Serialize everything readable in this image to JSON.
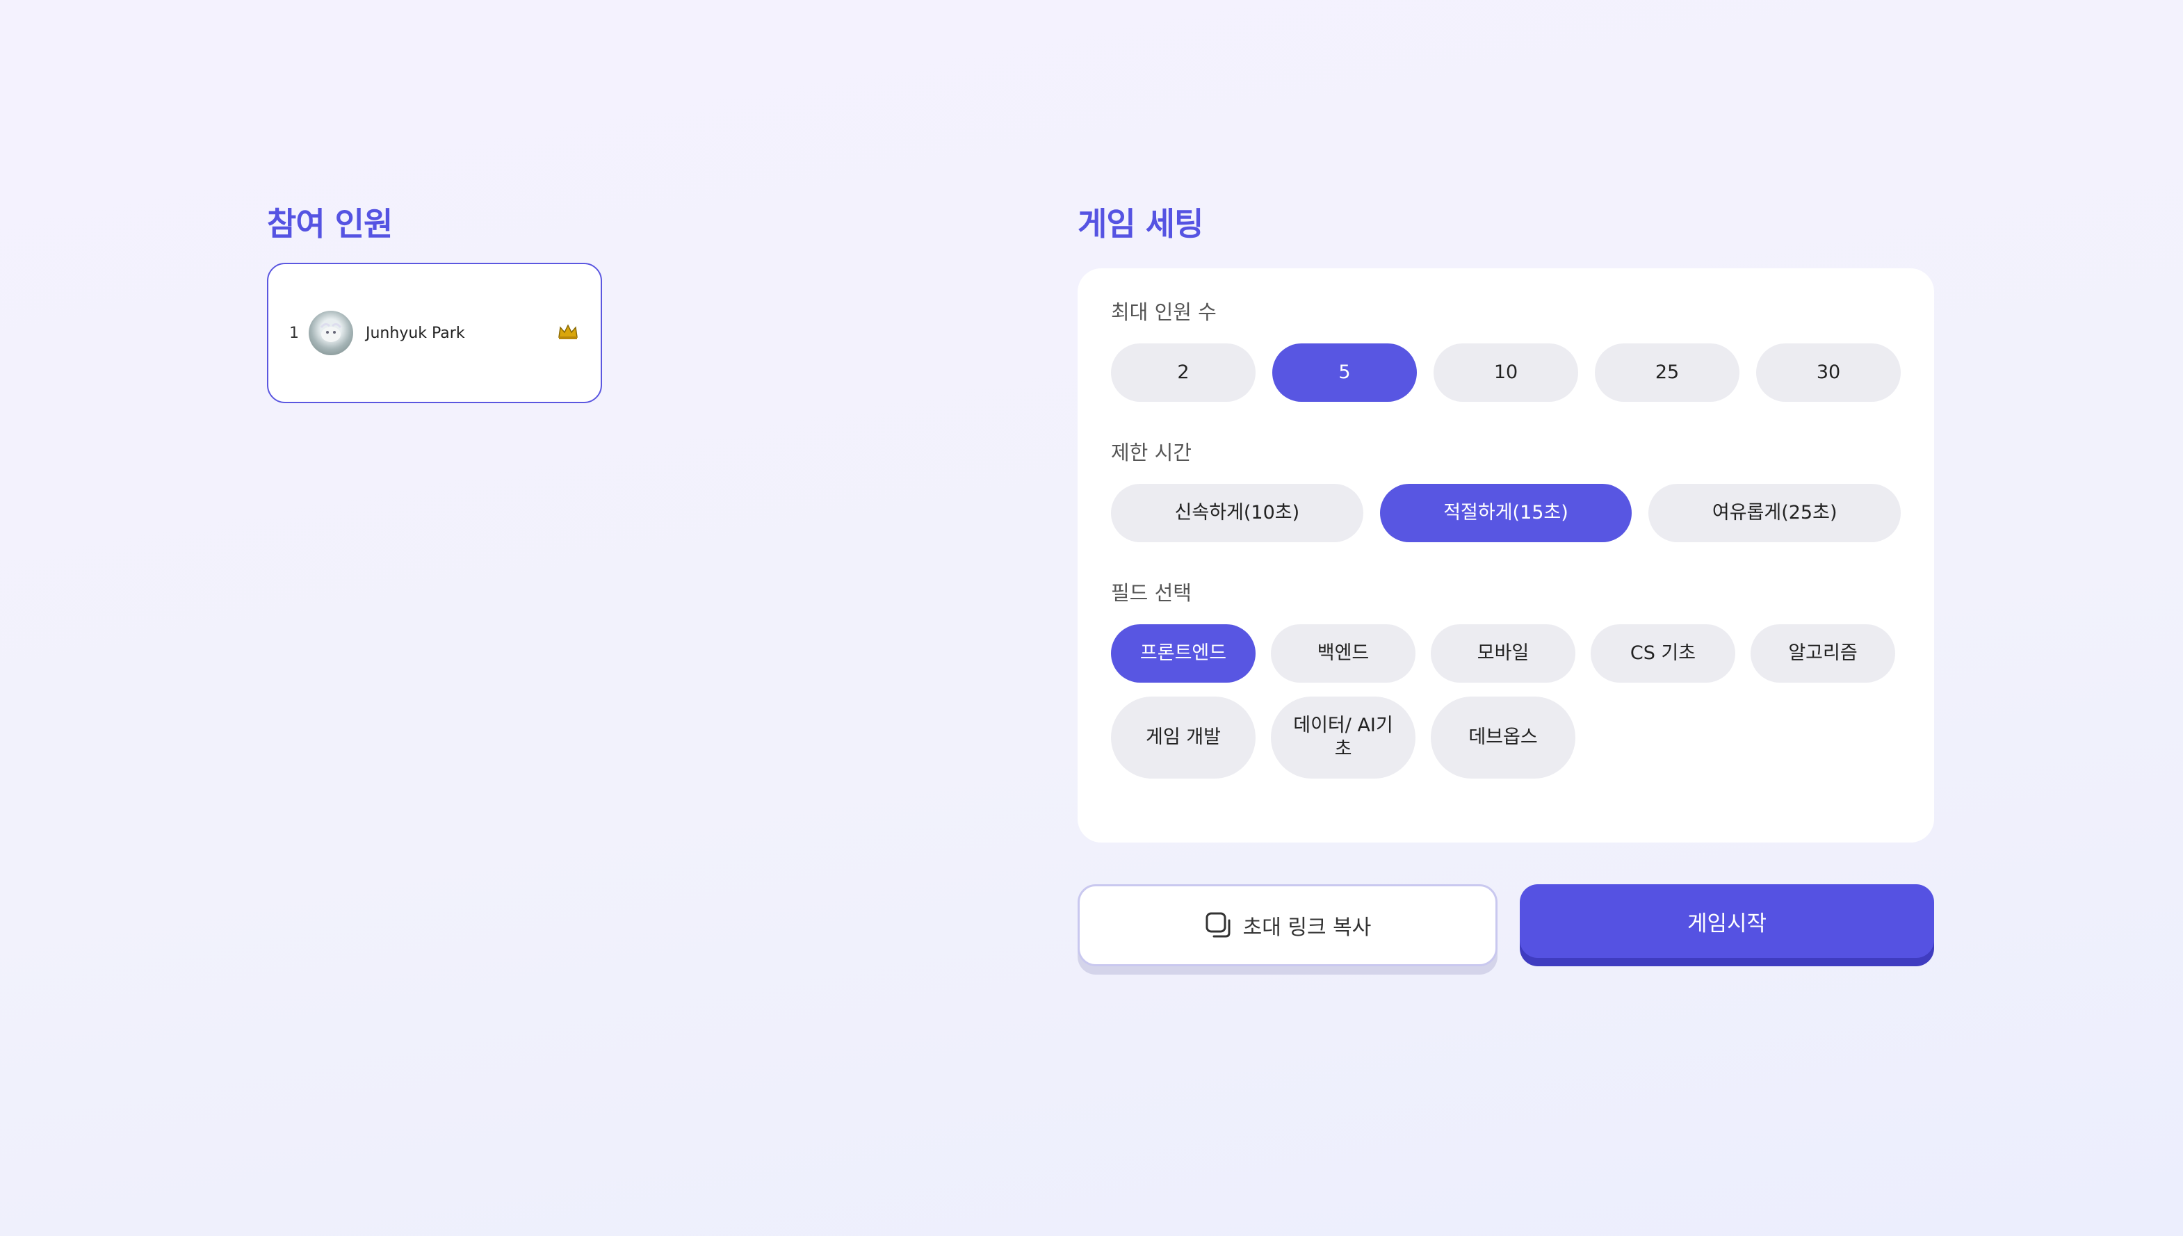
{
  "participants": {
    "title": "참여 인원",
    "players": [
      {
        "number": "1",
        "name": "Junhyuk Park",
        "is_host": true,
        "host_icon": "crown-icon"
      }
    ]
  },
  "settings": {
    "title": "게임 세팅",
    "max_players": {
      "label": "최대 인원 수",
      "options": [
        "2",
        "5",
        "10",
        "25",
        "30"
      ],
      "selected": "5"
    },
    "time_limit": {
      "label": "제한 시간",
      "options": [
        "신속하게(10초)",
        "적절하게(15초)",
        "여유롭게(25초)"
      ],
      "selected": "적절하게(15초)"
    },
    "field": {
      "label": "필드 선택",
      "options_row1": [
        "프론트엔드",
        "백엔드",
        "모바일",
        "CS 기초",
        "알고리즘"
      ],
      "options_row2": [
        "게임 개발",
        "데이터/ AI기초",
        "데브옵스"
      ],
      "selected": "프론트엔드"
    }
  },
  "actions": {
    "invite_label": "초대 링크 복사",
    "invite_icon": "copy-icon",
    "start_label": "게임시작"
  },
  "colors": {
    "accent": "#5856e2",
    "chip_bg": "#ececf1"
  }
}
